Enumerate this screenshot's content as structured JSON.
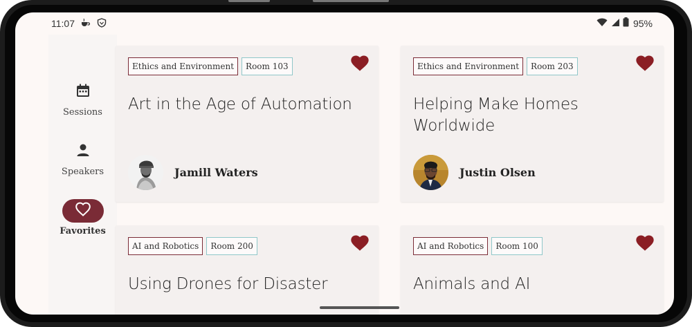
{
  "status_bar": {
    "time": "11:07",
    "battery_percent": "95%",
    "icons": [
      "tea-notification-icon",
      "shield-notification-icon",
      "wifi-icon",
      "signal-icon",
      "battery-icon"
    ]
  },
  "nav": {
    "items": [
      {
        "label": "Sessions",
        "icon": "calendar-icon",
        "active": false
      },
      {
        "label": "Speakers",
        "icon": "person-icon",
        "active": false
      },
      {
        "label": "Favorites",
        "icon": "heart-outline-icon",
        "active": true
      }
    ]
  },
  "cards": [
    {
      "topic": "Ethics and Environment",
      "room": "Room 103",
      "title": "Art in the Age of Automation",
      "speaker": "Jamill Waters",
      "favorited": true
    },
    {
      "topic": "Ethics and Environment",
      "room": "Room 203",
      "title": "Helping Make Homes Worldwide",
      "speaker": "Justin Olsen",
      "favorited": true
    },
    {
      "topic": "AI and Robotics",
      "room": "Room 200",
      "title": "Using Drones for Disaster",
      "speaker": "",
      "favorited": true
    },
    {
      "topic": "AI and Robotics",
      "room": "Room 100",
      "title": "Animals and AI",
      "speaker": "",
      "favorited": true
    }
  ],
  "colors": {
    "accent": "#7a2b36",
    "heart": "#8b1e24",
    "room_tag_border": "#8fc7c9",
    "background": "#fdf8f6",
    "card": "#f4f0ef"
  }
}
